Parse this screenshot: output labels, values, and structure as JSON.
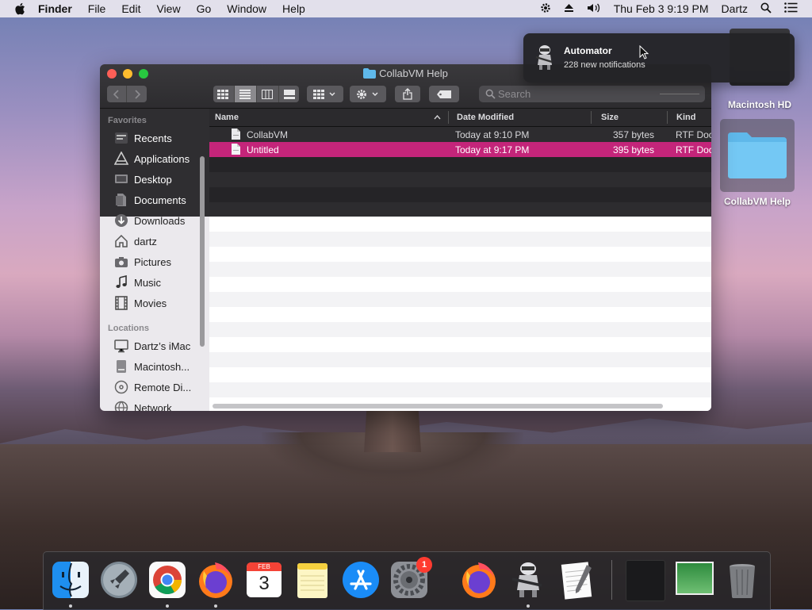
{
  "menubar": {
    "app_name": "Finder",
    "items": [
      "File",
      "Edit",
      "View",
      "Go",
      "Window",
      "Help"
    ],
    "clock": "Thu Feb 3  9:19 PM",
    "user": "Dartz"
  },
  "notification": {
    "title": "Automator",
    "subtitle": "228 new notifications"
  },
  "desktop": {
    "disk_label": "Macintosh HD",
    "folder_label": "CollabVM Help"
  },
  "window": {
    "title": "CollabVM Help",
    "search_placeholder": "Search",
    "sidebar": {
      "favorites_heading": "Favorites",
      "favorites": [
        "Recents",
        "Applications",
        "Desktop",
        "Documents",
        "Downloads",
        "dartz",
        "Pictures",
        "Music",
        "Movies"
      ],
      "locations_heading": "Locations",
      "locations": [
        "Dartz’s iMac",
        "Macintosh...",
        "Remote Di...",
        "Network"
      ]
    },
    "columns": [
      "Name",
      "Date Modified",
      "Size",
      "Kind"
    ],
    "files": [
      {
        "name": "CollabVM",
        "date": "Today at 9:10 PM",
        "size": "357 bytes",
        "kind": "RTF Doc"
      },
      {
        "name": "Untitled",
        "date": "Today at 9:17 PM",
        "size": "395 bytes",
        "kind": "RTF Doc"
      }
    ],
    "selected_row": 1
  },
  "dock": {
    "calendar_month": "FEB",
    "calendar_day": "3",
    "badge_count": "1"
  },
  "colors": {
    "selection": "#c4257a",
    "sidebar_bg": "#ebe9ed",
    "titlebar": "#2d2c2f"
  }
}
